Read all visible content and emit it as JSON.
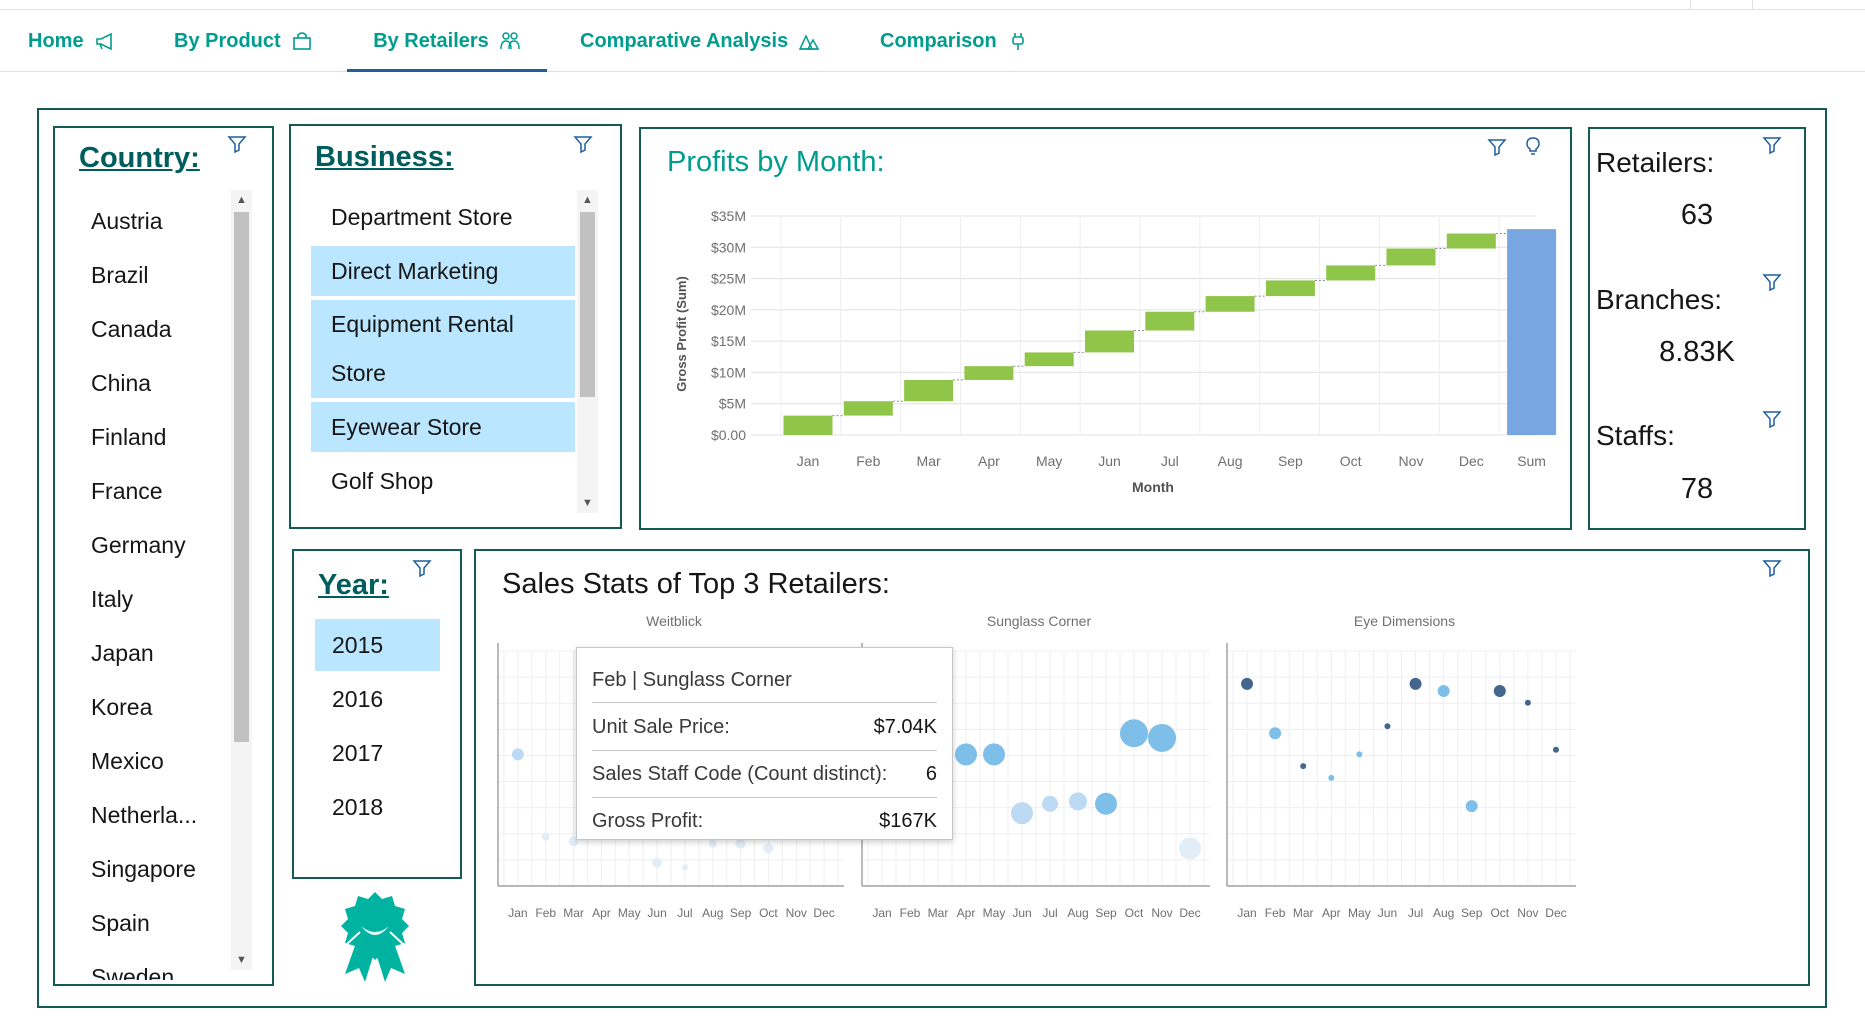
{
  "tabs": [
    {
      "label": "Home",
      "icon": "megaphone-icon"
    },
    {
      "label": "By Product",
      "icon": "shopping-bag-icon"
    },
    {
      "label": "By Retailers",
      "icon": "people-icon"
    },
    {
      "label": "Comparative Analysis",
      "icon": "triangles-icon"
    },
    {
      "label": "Comparison",
      "icon": "plug-icon"
    }
  ],
  "active_tab": "By Retailers",
  "colors": {
    "accent": "#009d8f",
    "border": "#135b54",
    "selected": "#bae6ff",
    "bar_green": "#8fc549",
    "bar_blue": "#78a6e0"
  },
  "country": {
    "heading": "Country:",
    "items": [
      "Austria",
      "Brazil",
      "Canada",
      "China",
      "Finland",
      "France",
      "Germany",
      "Italy",
      "Japan",
      "Korea",
      "Mexico",
      "Netherla...",
      "Singapore",
      "Spain",
      "Sweden"
    ]
  },
  "business": {
    "heading": "Business:",
    "items": [
      {
        "label": "Department Store",
        "selected": false
      },
      {
        "label": "Direct Marketing",
        "selected": true
      },
      {
        "label": "Equipment Rental",
        "label2": "Store",
        "selected": true
      },
      {
        "label": "Eyewear Store",
        "selected": true
      },
      {
        "label": "Golf Shop",
        "selected": false
      }
    ]
  },
  "year": {
    "heading": "Year:",
    "items": [
      {
        "label": "2015",
        "selected": true
      },
      {
        "label": "2016",
        "selected": false
      },
      {
        "label": "2017",
        "selected": false
      },
      {
        "label": "2018",
        "selected": false
      }
    ]
  },
  "kpis": {
    "retailers_label": "Retailers:",
    "retailers_value": "63",
    "branches_label": "Branches:",
    "branches_value": "8.83K",
    "staffs_label": "Staffs:",
    "staffs_value": "78"
  },
  "profits_title": "Profits by Month:",
  "sales_title": "Sales Stats of Top 3 Retailers:",
  "tooltip": {
    "header": "Feb | Sunglass Corner",
    "rows": [
      {
        "label": "Unit Sale Price:",
        "value": "$7.04K"
      },
      {
        "label": "Sales Staff Code (Count distinct):",
        "value": "6"
      },
      {
        "label": "Gross Profit:",
        "value": "$167K"
      }
    ]
  },
  "chart_data": [
    {
      "type": "bar",
      "subtype": "waterfall",
      "xlabel": "Month",
      "ylabel": "Gross Profit (Sum)",
      "ylim": [
        0,
        35
      ],
      "yticks": [
        "$0.00",
        "$5M",
        "$10M",
        "$15M",
        "$20M",
        "$25M",
        "$30M",
        "$35M"
      ],
      "categories": [
        "Jan",
        "Feb",
        "Mar",
        "Apr",
        "May",
        "Jun",
        "Jul",
        "Aug",
        "Sep",
        "Oct",
        "Nov",
        "Dec",
        "Sum"
      ],
      "increments": [
        3.1,
        2.3,
        3.4,
        2.2,
        2.2,
        3.5,
        3.0,
        2.5,
        2.5,
        2.4,
        2.7,
        2.4
      ],
      "total": 32.9,
      "units": "$M",
      "grid": true
    },
    {
      "type": "scatter",
      "subtype": "bubble",
      "panels": [
        "Weitblick",
        "Sunglass Corner",
        "Eye Dimensions"
      ],
      "categories": [
        "Jan",
        "Feb",
        "Mar",
        "Apr",
        "May",
        "Jun",
        "Jul",
        "Aug",
        "Sep",
        "Oct",
        "Nov",
        "Dec"
      ],
      "series": [
        {
          "panel": "Weitblick",
          "points": [
            {
              "x": "Jan",
              "y": 0.56,
              "size": 6,
              "shade": "light"
            },
            {
              "x": "Feb",
              "y": 0.21,
              "size": 4,
              "shade": "faint"
            },
            {
              "x": "Mar",
              "y": 0.19,
              "size": 5,
              "shade": "faint"
            },
            {
              "x": "Jun",
              "y": 0.1,
              "size": 5,
              "shade": "faint"
            },
            {
              "x": "Jul",
              "y": 0.08,
              "size": 3,
              "shade": "faint"
            },
            {
              "x": "Aug",
              "y": 0.18,
              "size": 4,
              "shade": "faint"
            },
            {
              "x": "Sep",
              "y": 0.18,
              "size": 5,
              "shade": "faint"
            },
            {
              "x": "Oct",
              "y": 0.16,
              "size": 5,
              "shade": "faint"
            }
          ]
        },
        {
          "panel": "Sunglass Corner",
          "points": [
            {
              "x": "Jan",
              "y": 0.31,
              "size": 11,
              "shade": "faint"
            },
            {
              "x": "Feb",
              "y": 0.56,
              "size": 13,
              "shade": "highlight"
            },
            {
              "x": "Mar",
              "y": 0.4,
              "size": 11,
              "shade": "mid"
            },
            {
              "x": "Apr",
              "y": 0.56,
              "size": 11,
              "shade": "mid"
            },
            {
              "x": "May",
              "y": 0.56,
              "size": 11,
              "shade": "mid"
            },
            {
              "x": "Jun",
              "y": 0.31,
              "size": 11,
              "shade": "light"
            },
            {
              "x": "Jul",
              "y": 0.35,
              "size": 8,
              "shade": "light"
            },
            {
              "x": "Aug",
              "y": 0.36,
              "size": 9,
              "shade": "light"
            },
            {
              "x": "Sep",
              "y": 0.35,
              "size": 11,
              "shade": "mid"
            },
            {
              "x": "Oct",
              "y": 0.65,
              "size": 14,
              "shade": "mid"
            },
            {
              "x": "Nov",
              "y": 0.63,
              "size": 14,
              "shade": "mid"
            },
            {
              "x": "Dec",
              "y": 0.16,
              "size": 11,
              "shade": "faint"
            }
          ]
        },
        {
          "panel": "Eye Dimensions",
          "points": [
            {
              "x": "Jan",
              "y": 0.86,
              "size": 6,
              "shade": "dark"
            },
            {
              "x": "Feb",
              "y": 0.65,
              "size": 6,
              "shade": "mid"
            },
            {
              "x": "Mar",
              "y": 0.51,
              "size": 3,
              "shade": "dark"
            },
            {
              "x": "Apr",
              "y": 0.46,
              "size": 3,
              "shade": "mid"
            },
            {
              "x": "May",
              "y": 0.56,
              "size": 3,
              "shade": "mid"
            },
            {
              "x": "Jun",
              "y": 0.68,
              "size": 3,
              "shade": "dark"
            },
            {
              "x": "Jul",
              "y": 0.86,
              "size": 6,
              "shade": "dark"
            },
            {
              "x": "Aug",
              "y": 0.83,
              "size": 6,
              "shade": "mid"
            },
            {
              "x": "Sep",
              "y": 0.34,
              "size": 6,
              "shade": "mid"
            },
            {
              "x": "Oct",
              "y": 0.83,
              "size": 6,
              "shade": "dark"
            },
            {
              "x": "Nov",
              "y": 0.78,
              "size": 3,
              "shade": "dark"
            },
            {
              "x": "Dec",
              "y": 0.58,
              "size": 3,
              "shade": "dark"
            }
          ]
        }
      ]
    }
  ]
}
